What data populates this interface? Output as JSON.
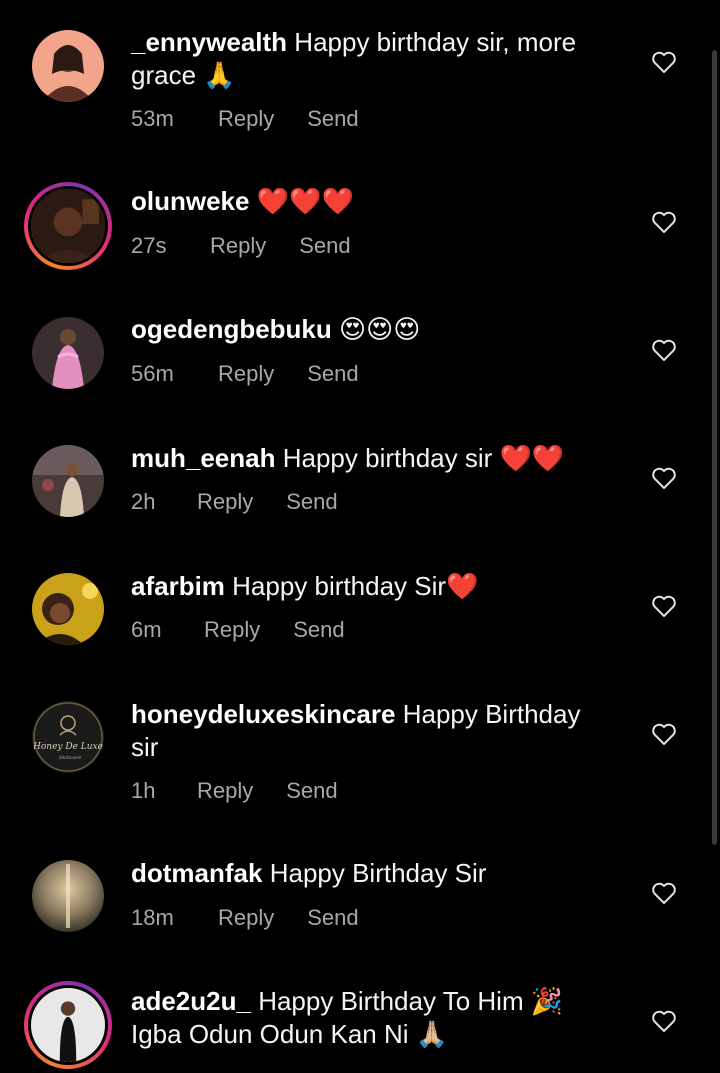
{
  "comments": [
    {
      "username": "_ennywealth",
      "text": "Happy birthday sir, more grace 🙏",
      "time": "53m",
      "reply": "Reply",
      "send": "Send"
    },
    {
      "username": "olunweke",
      "text": "❤️❤️❤️",
      "time": "27s",
      "reply": "Reply",
      "send": "Send"
    },
    {
      "username": "ogedengbebuku",
      "text": "😍😍😍",
      "time": "56m",
      "reply": "Reply",
      "send": "Send"
    },
    {
      "username": "muh_eenah",
      "text": "Happy birthday sir ❤️❤️",
      "time": "2h",
      "reply": "Reply",
      "send": "Send"
    },
    {
      "username": "afarbim",
      "text": "Happy birthday Sir❤️",
      "time": "6m",
      "reply": "Reply",
      "send": "Send"
    },
    {
      "username": "honeydeluxeskincare",
      "text": "Happy Birthday sir",
      "time": "1h",
      "reply": "Reply",
      "send": "Send",
      "avatar_text": "Honey De Luxe",
      "avatar_subtext": "Skincare"
    },
    {
      "username": "dotmanfak",
      "text": "Happy Birthday Sir",
      "time": "18m",
      "reply": "Reply",
      "send": "Send"
    },
    {
      "username": "ade2u2u_",
      "text": "Happy Birthday To Him 🎉 Igba Odun Odun Kan Ni 🙏🏼"
    }
  ],
  "colors": {
    "background": "#000000",
    "meta_text": "#a8a8a8",
    "story_ring": [
      "#f58529",
      "#dd2a7b",
      "#8134af"
    ]
  },
  "icons": {
    "like": "heart-outline-icon"
  }
}
